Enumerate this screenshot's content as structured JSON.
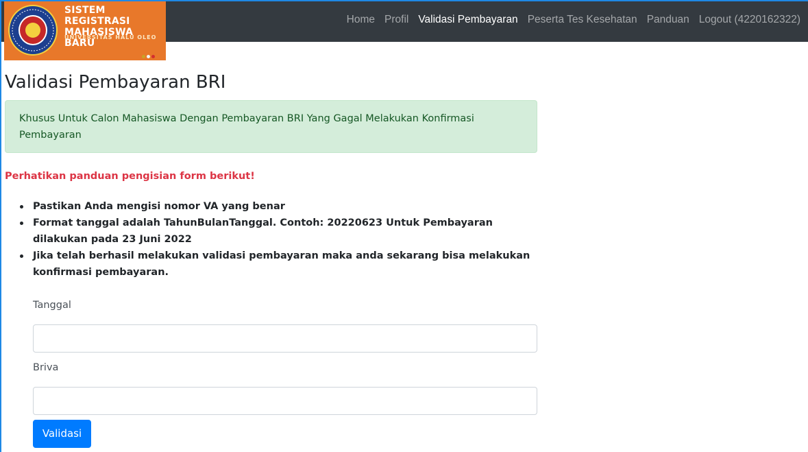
{
  "brand": {
    "title_line1": "SISTEM REGISTRASI",
    "title_line2": "MAHASISWA BARU",
    "subtitle": "UNIVERSITAS HALU OLEO",
    "logo_icon": "university-seal-icon",
    "dot_colors": [
      "#c9a227",
      "#f5f5f5",
      "#d32f2f"
    ]
  },
  "nav": {
    "items": [
      {
        "label": "Home"
      },
      {
        "label": "Profil"
      },
      {
        "label": "Validasi Pembayaran",
        "active": true
      },
      {
        "label": "Peserta Tes Kesehatan"
      },
      {
        "label": "Panduan"
      },
      {
        "label": "Logout (4220162322)"
      }
    ]
  },
  "page": {
    "title": "Validasi Pembayaran BRI",
    "alert": "Khusus Untuk Calon Mahasiswa Dengan Pembayaran BRI Yang Gagal Melakukan Konfirmasi Pembayaran",
    "guide_heading": "Perhatikan panduan pengisian form berikut!",
    "guide_items": [
      "Pastikan Anda mengisi nomor VA yang benar",
      "Format tanggal adalah TahunBulanTanggal. Contoh: 20220623 Untuk Pembayaran dilakukan pada 23 Juni 2022",
      "Jika telah berhasil melakukan validasi pembayaran maka anda sekarang bisa melakukan konfirmasi pembayaran."
    ]
  },
  "form": {
    "tanggal_label": "Tanggal",
    "tanggal_value": "",
    "briva_label": "Briva",
    "briva_value": "",
    "submit_label": "Validasi"
  },
  "colors": {
    "navbar_bg": "#343a40",
    "brand_bg": "#e8782a",
    "alert_bg": "#d4edda",
    "alert_text": "#155724",
    "danger": "#dc3545",
    "primary": "#007bff"
  }
}
